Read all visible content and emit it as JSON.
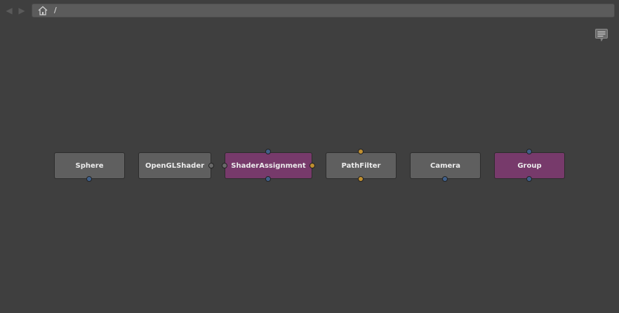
{
  "toolbar": {
    "path": "/",
    "back_icon": "arrow-left-icon",
    "forward_icon": "arrow-right-icon",
    "home_icon": "home-icon",
    "comment_icon": "comment-icon"
  },
  "nodes": [
    {
      "label": "Sphere",
      "style": "grey"
    },
    {
      "label": "OpenGLShader",
      "style": "grey"
    },
    {
      "label": "ShaderAssignment",
      "style": "purple"
    },
    {
      "label": "PathFilter",
      "style": "grey"
    },
    {
      "label": "Camera",
      "style": "grey"
    },
    {
      "label": "Group",
      "style": "purple"
    }
  ],
  "colors": {
    "background": "#3f3f3f",
    "node_grey": "#5f5f5f",
    "node_purple": "#773a6b",
    "plug_blue": "#40608a",
    "plug_orange": "#c08f30"
  }
}
